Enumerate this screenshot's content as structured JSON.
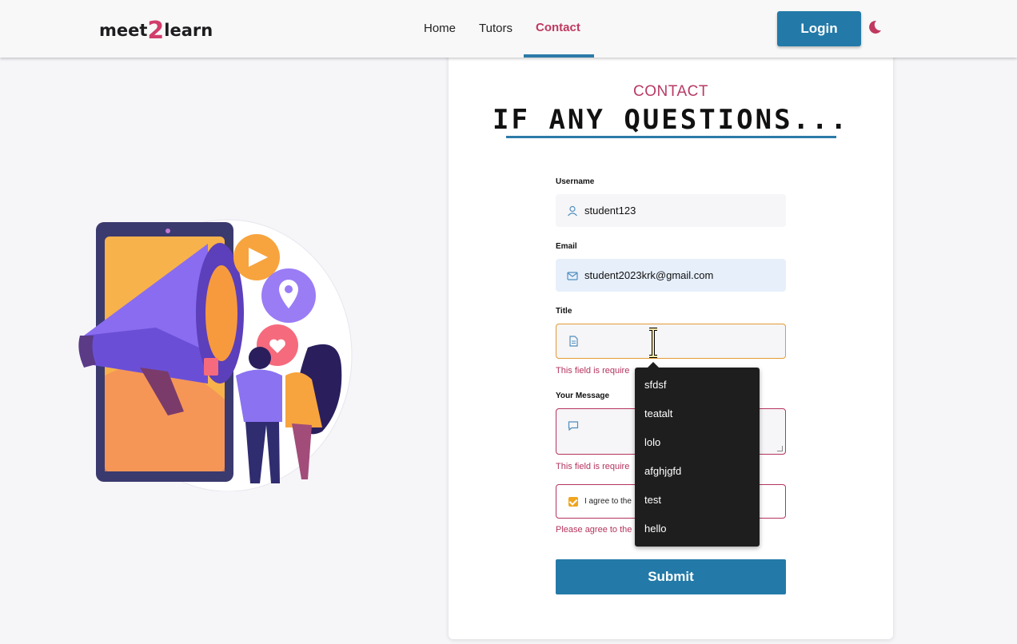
{
  "header": {
    "logo": {
      "part1": "meet",
      "part2": "2",
      "part3": "learn"
    },
    "nav": [
      {
        "label": "Home",
        "active": false
      },
      {
        "label": "Tutors",
        "active": false
      },
      {
        "label": "Contact",
        "active": true
      }
    ],
    "login_label": "Login",
    "theme_icon": "moon-icon"
  },
  "contact": {
    "label": "CONTACT",
    "title": "IF ANY QUESTIONS..."
  },
  "form": {
    "username": {
      "label": "Username",
      "value": "student123",
      "icon": "user-icon"
    },
    "email": {
      "label": "Email",
      "value": "student2023krk@gmail.com",
      "icon": "mail-icon"
    },
    "title": {
      "label": "Title",
      "value": "",
      "icon": "document-icon",
      "error": "This field is require"
    },
    "message": {
      "label": "Your Message",
      "value": "",
      "icon": "chat-icon",
      "error": "This field is require"
    },
    "agree": {
      "label": "I agree to the",
      "checked": true,
      "error": "Please agree to the"
    },
    "submit_label": "Submit"
  },
  "autocomplete": {
    "options": [
      "sfdsf",
      "teatalt",
      "lolo",
      "afghjgfd",
      "test",
      "hello"
    ]
  },
  "colors": {
    "accent_blue": "#237aa8",
    "accent_pink": "#c0395f",
    "error": "#b5345d",
    "focus": "#e39a36"
  }
}
